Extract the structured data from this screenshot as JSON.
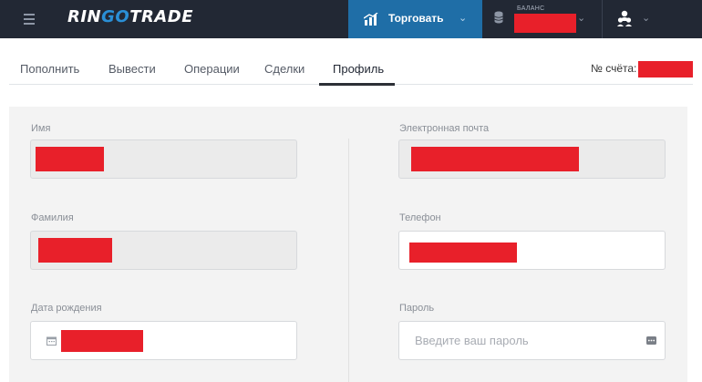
{
  "topbar": {
    "logo_part1": "RIN",
    "logo_part2": "GO",
    "logo_part3": "TRADE",
    "trade_label": "Торговать",
    "balance_caption": "БАЛАНС",
    "brand_color": "#1f6ea7",
    "redact_color": "#e8202a",
    "icons": [
      "menu-icon",
      "trade-icon",
      "chevron-down-icon",
      "database-icon",
      "user-group-icon"
    ]
  },
  "tabs": [
    {
      "label": "Пополнить"
    },
    {
      "label": "Вывести"
    },
    {
      "label": "Операции"
    },
    {
      "label": "Сделки"
    },
    {
      "label": "Профиль",
      "active": true
    }
  ],
  "account_label": "№ счёта:",
  "form": {
    "first_name_label": "Имя",
    "last_name_label": "Фамилия",
    "birth_date_label": "Дата рождения",
    "email_label": "Электронная почта",
    "phone_label": "Телефон",
    "password_label": "Пароль",
    "password_placeholder": "Введите ваш пароль"
  }
}
